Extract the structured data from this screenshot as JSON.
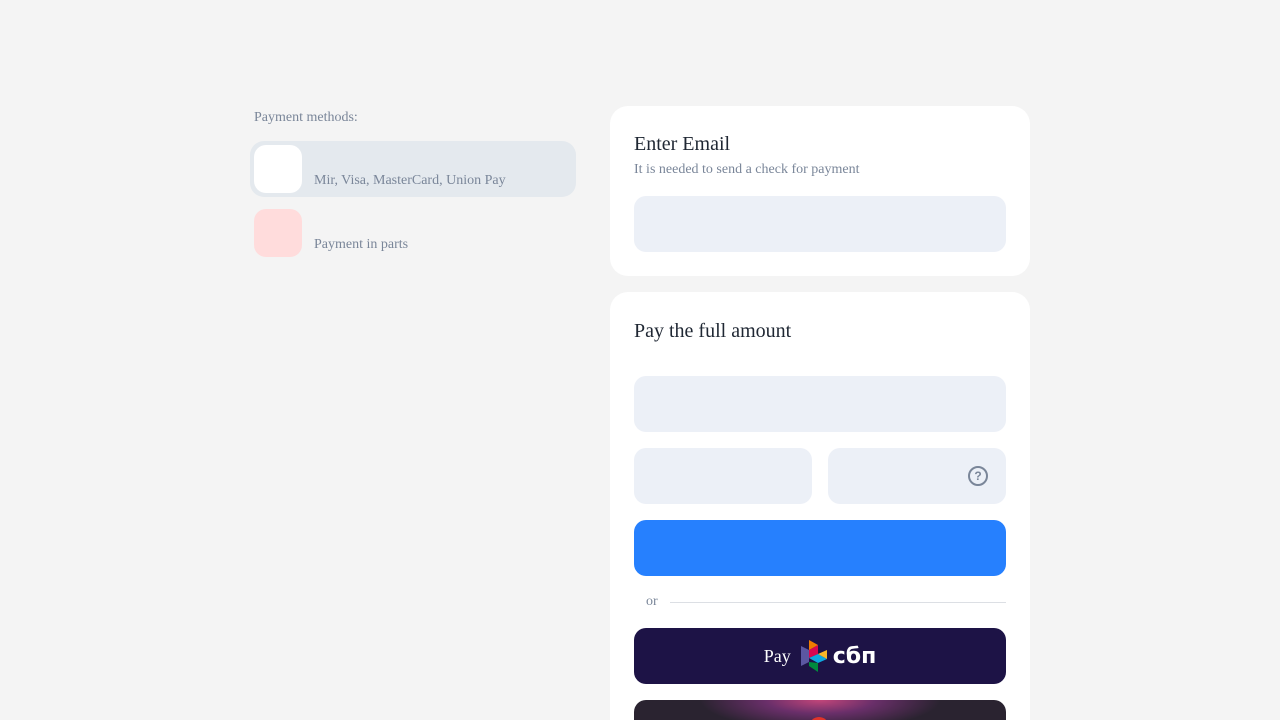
{
  "payment_methods": {
    "title": "Payment methods:",
    "items": [
      {
        "label": "Mir, Visa, MasterCard, Union Pay",
        "active": true
      },
      {
        "label": "Payment in parts",
        "active": false
      }
    ]
  },
  "email_card": {
    "title": "Enter Email",
    "subtitle": "It is needed to send a check for payment",
    "email_value": ""
  },
  "pay_card": {
    "title": "Pay the full amount",
    "card_number_value": "",
    "expiry_value": "",
    "cvc_value": "",
    "help_glyph": "?",
    "pay_button_label": "",
    "or_label": "or",
    "sbp_button": {
      "prefix": "Pay",
      "logo_text": "сбп"
    }
  },
  "colors": {
    "background": "#f4f4f4",
    "accent": "#2680fe",
    "sbp_button": "#1d1346",
    "field": "#ecf0f7",
    "muted_text": "#7a8699"
  },
  "icons": [
    "help-circle-icon",
    "sbp-logo-icon"
  ]
}
